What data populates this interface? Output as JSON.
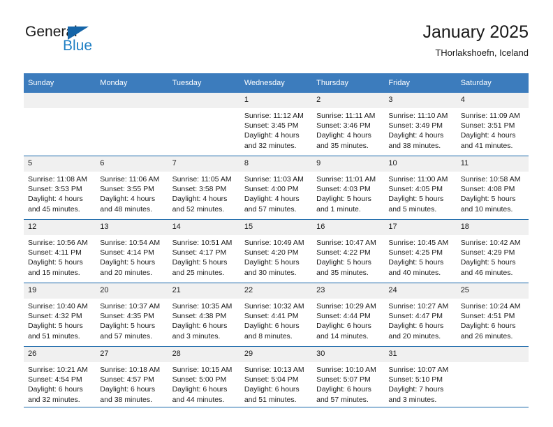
{
  "brand": {
    "word1": "General",
    "word2": "Blue",
    "accent": "#1565a8",
    "accent_text": "#1f7fc4",
    "triangle_icon": "brand-triangle-icon"
  },
  "header": {
    "title": "January 2025",
    "subtitle": "THorlakshoefn, Iceland",
    "header_bg": "#3c7cbd",
    "rule_color": "#1565a8",
    "daynum_bg": "#f0f0f0"
  },
  "weekday_headers": [
    "Sunday",
    "Monday",
    "Tuesday",
    "Wednesday",
    "Thursday",
    "Friday",
    "Saturday"
  ],
  "labels": {
    "sunrise": "Sunrise:",
    "sunset": "Sunset:",
    "daylight": "Daylight:"
  },
  "weeks": [
    [
      {
        "day": "",
        "info": ""
      },
      {
        "day": "",
        "info": ""
      },
      {
        "day": "",
        "info": ""
      },
      {
        "day": "1",
        "info": "Sunrise: 11:12 AM\nSunset: 3:45 PM\nDaylight: 4 hours\nand 32 minutes."
      },
      {
        "day": "2",
        "info": "Sunrise: 11:11 AM\nSunset: 3:46 PM\nDaylight: 4 hours\nand 35 minutes."
      },
      {
        "day": "3",
        "info": "Sunrise: 11:10 AM\nSunset: 3:49 PM\nDaylight: 4 hours\nand 38 minutes."
      },
      {
        "day": "4",
        "info": "Sunrise: 11:09 AM\nSunset: 3:51 PM\nDaylight: 4 hours\nand 41 minutes."
      }
    ],
    [
      {
        "day": "5",
        "info": "Sunrise: 11:08 AM\nSunset: 3:53 PM\nDaylight: 4 hours\nand 45 minutes."
      },
      {
        "day": "6",
        "info": "Sunrise: 11:06 AM\nSunset: 3:55 PM\nDaylight: 4 hours\nand 48 minutes."
      },
      {
        "day": "7",
        "info": "Sunrise: 11:05 AM\nSunset: 3:58 PM\nDaylight: 4 hours\nand 52 minutes."
      },
      {
        "day": "8",
        "info": "Sunrise: 11:03 AM\nSunset: 4:00 PM\nDaylight: 4 hours\nand 57 minutes."
      },
      {
        "day": "9",
        "info": "Sunrise: 11:01 AM\nSunset: 4:03 PM\nDaylight: 5 hours\nand 1 minute."
      },
      {
        "day": "10",
        "info": "Sunrise: 11:00 AM\nSunset: 4:05 PM\nDaylight: 5 hours\nand 5 minutes."
      },
      {
        "day": "11",
        "info": "Sunrise: 10:58 AM\nSunset: 4:08 PM\nDaylight: 5 hours\nand 10 minutes."
      }
    ],
    [
      {
        "day": "12",
        "info": "Sunrise: 10:56 AM\nSunset: 4:11 PM\nDaylight: 5 hours\nand 15 minutes."
      },
      {
        "day": "13",
        "info": "Sunrise: 10:54 AM\nSunset: 4:14 PM\nDaylight: 5 hours\nand 20 minutes."
      },
      {
        "day": "14",
        "info": "Sunrise: 10:51 AM\nSunset: 4:17 PM\nDaylight: 5 hours\nand 25 minutes."
      },
      {
        "day": "15",
        "info": "Sunrise: 10:49 AM\nSunset: 4:20 PM\nDaylight: 5 hours\nand 30 minutes."
      },
      {
        "day": "16",
        "info": "Sunrise: 10:47 AM\nSunset: 4:22 PM\nDaylight: 5 hours\nand 35 minutes."
      },
      {
        "day": "17",
        "info": "Sunrise: 10:45 AM\nSunset: 4:25 PM\nDaylight: 5 hours\nand 40 minutes."
      },
      {
        "day": "18",
        "info": "Sunrise: 10:42 AM\nSunset: 4:29 PM\nDaylight: 5 hours\nand 46 minutes."
      }
    ],
    [
      {
        "day": "19",
        "info": "Sunrise: 10:40 AM\nSunset: 4:32 PM\nDaylight: 5 hours\nand 51 minutes."
      },
      {
        "day": "20",
        "info": "Sunrise: 10:37 AM\nSunset: 4:35 PM\nDaylight: 5 hours\nand 57 minutes."
      },
      {
        "day": "21",
        "info": "Sunrise: 10:35 AM\nSunset: 4:38 PM\nDaylight: 6 hours\nand 3 minutes."
      },
      {
        "day": "22",
        "info": "Sunrise: 10:32 AM\nSunset: 4:41 PM\nDaylight: 6 hours\nand 8 minutes."
      },
      {
        "day": "23",
        "info": "Sunrise: 10:29 AM\nSunset: 4:44 PM\nDaylight: 6 hours\nand 14 minutes."
      },
      {
        "day": "24",
        "info": "Sunrise: 10:27 AM\nSunset: 4:47 PM\nDaylight: 6 hours\nand 20 minutes."
      },
      {
        "day": "25",
        "info": "Sunrise: 10:24 AM\nSunset: 4:51 PM\nDaylight: 6 hours\nand 26 minutes."
      }
    ],
    [
      {
        "day": "26",
        "info": "Sunrise: 10:21 AM\nSunset: 4:54 PM\nDaylight: 6 hours\nand 32 minutes."
      },
      {
        "day": "27",
        "info": "Sunrise: 10:18 AM\nSunset: 4:57 PM\nDaylight: 6 hours\nand 38 minutes."
      },
      {
        "day": "28",
        "info": "Sunrise: 10:15 AM\nSunset: 5:00 PM\nDaylight: 6 hours\nand 44 minutes."
      },
      {
        "day": "29",
        "info": "Sunrise: 10:13 AM\nSunset: 5:04 PM\nDaylight: 6 hours\nand 51 minutes."
      },
      {
        "day": "30",
        "info": "Sunrise: 10:10 AM\nSunset: 5:07 PM\nDaylight: 6 hours\nand 57 minutes."
      },
      {
        "day": "31",
        "info": "Sunrise: 10:07 AM\nSunset: 5:10 PM\nDaylight: 7 hours\nand 3 minutes."
      },
      {
        "day": "",
        "info": ""
      }
    ]
  ]
}
